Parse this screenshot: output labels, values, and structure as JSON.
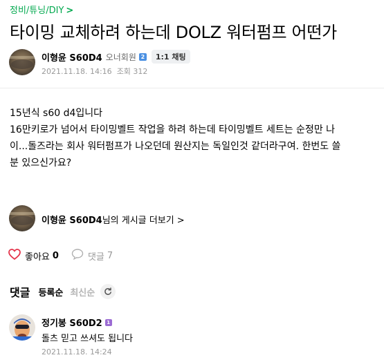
{
  "breadcrumb": {
    "label": "정비/튜닝/DIY",
    "chevron": ">"
  },
  "post": {
    "title": "타이밍 교체하려 하는데 DOLZ 워터펌프 어떤가",
    "author": {
      "name": "이형윤 S60D4",
      "grade": "오너회원",
      "grade_badge": "2",
      "chat_label": "1:1 채팅"
    },
    "date": "2021.11.18. 14:16",
    "views": "조회 312",
    "body_lines": [
      "15년식 s60 d4입니다",
      "16만키로가 넘어서 타이밍벨트 작업을 하려 하는데 타이밍벨트 세트는 순정만 나",
      "이...돌즈라는 회사 워터펌프가 나오던데 원산지는 독일인것 같더라구여. 한번도 쓸",
      "분 있으신가요?"
    ]
  },
  "more_posts": {
    "name": "이형윤 S60D4",
    "suffix": "님의 게시글 더보기",
    "chevron": ">"
  },
  "actions": {
    "like_label": "좋아요",
    "like_count": "0",
    "comment_label": "댓글",
    "comment_count": "7"
  },
  "comments": {
    "title": "댓글",
    "sort_registered": "등록순",
    "sort_latest": "최신순",
    "items": [
      {
        "name": "정기봉 S60D2",
        "badge": "1",
        "text": "돌츠 믿고 쓰셔도 됩니다",
        "date": "2021.11.18. 14:24"
      }
    ]
  },
  "colors": {
    "brand_green": "#03a94f",
    "like_red": "#e4344b",
    "muted": "#999999"
  }
}
